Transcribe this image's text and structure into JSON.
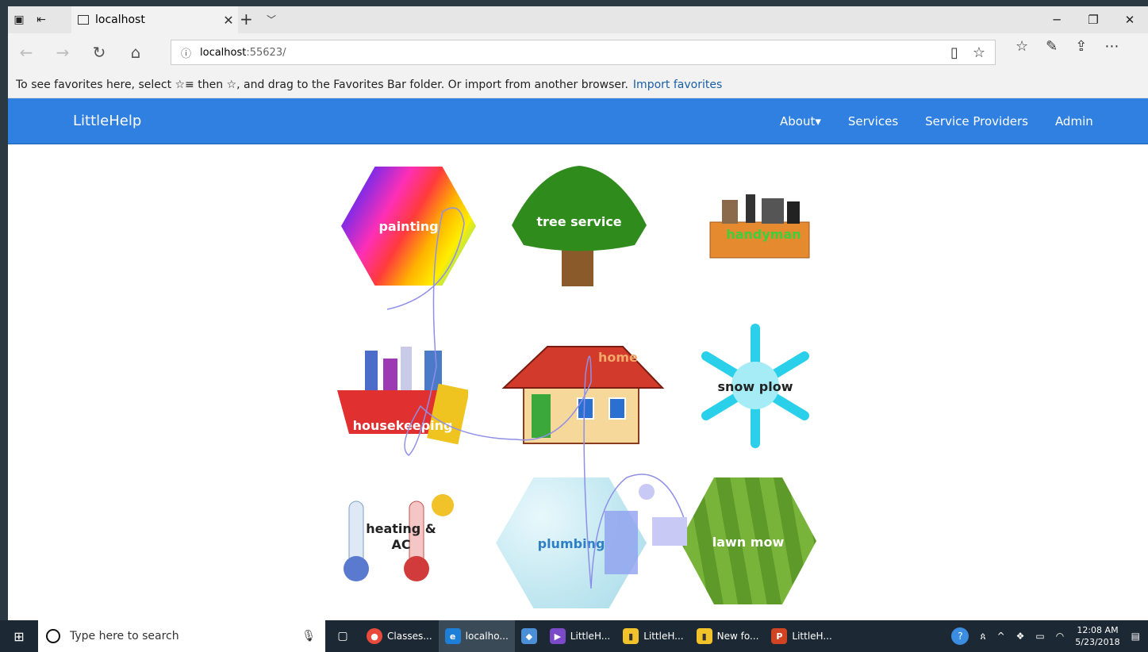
{
  "browser": {
    "tab_title": "localhost",
    "address_host": "localhost",
    "address_port": ":55623/",
    "favorites_message": "To see favorites here, select ☆≡ then ☆, and drag to the Favorites Bar folder. Or import from another browser.",
    "import_link": "Import favorites"
  },
  "site": {
    "brand": "LittleHelp",
    "menu": {
      "about": "About▾",
      "services": "Services",
      "service_providers": "Service Providers",
      "admin": "Admin"
    }
  },
  "services": {
    "painting": "painting",
    "tree_service": "tree service",
    "handyman": "handyman",
    "housekeeping": "housekeeping",
    "home": "home",
    "snow_plow": "snow plow",
    "heating_ac_line1": "heating &",
    "heating_ac_line2": "AC",
    "plumbing": "plumbing",
    "lawn_mow": "lawn mow"
  },
  "taskbar": {
    "search_placeholder": "Type here to search",
    "apps": {
      "chrome": "Classes...",
      "edge": "localho...",
      "vs": "LittleH...",
      "explorer1": "LittleH...",
      "explorer2": "New fo...",
      "powerpoint": "LittleH..."
    },
    "time": "12:08 AM",
    "date": "5/23/2018"
  },
  "colors": {
    "nav_blue": "#2f80e1",
    "link_blue": "#1a5ea6"
  }
}
